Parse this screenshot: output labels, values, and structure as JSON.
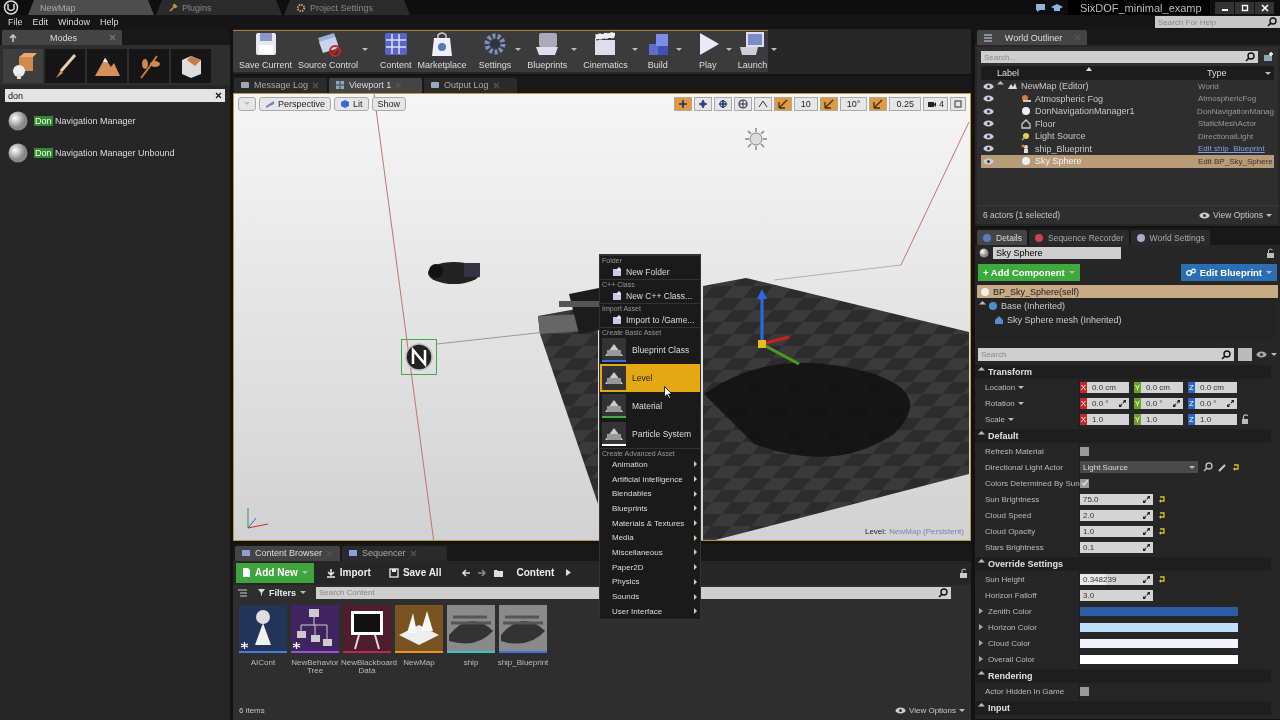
{
  "title_bar": {
    "tabs": [
      {
        "label": "NewMap",
        "selected": true
      },
      {
        "label": "Plugins",
        "selected": false
      },
      {
        "label": "Project Settings",
        "selected": false
      }
    ],
    "project": "SixDOF_minimal_examp"
  },
  "menu_bar": {
    "items": [
      "File",
      "Edit",
      "Window",
      "Help"
    ],
    "help_search": {
      "placeholder": "Search For Help"
    }
  },
  "modes_panel": {
    "tab": "Modes",
    "modes": [
      {
        "selected": true
      },
      {
        "selected": false
      },
      {
        "selected": false
      },
      {
        "selected": false
      },
      {
        "selected": false
      }
    ],
    "search": {
      "value": "don"
    },
    "results": [
      {
        "match": "Don",
        "rest": "Navigation Manager"
      },
      {
        "match": "Don",
        "rest": "Navigation Manager Unbound"
      }
    ]
  },
  "toolbar": [
    {
      "label": "Save Current",
      "dropdown": false
    },
    {
      "label": "Source Control",
      "dropdown": true
    },
    {
      "label": "Content",
      "dropdown": false
    },
    {
      "label": "Marketplace",
      "dropdown": false
    },
    {
      "label": "Settings",
      "dropdown": true
    },
    {
      "label": "Blueprints",
      "dropdown": true
    },
    {
      "label": "Cinematics",
      "dropdown": true
    },
    {
      "label": "Build",
      "dropdown": true
    },
    {
      "label": "Play",
      "dropdown": true
    },
    {
      "label": "Launch",
      "dropdown": true
    }
  ],
  "viewport": {
    "tabs": [
      {
        "label": "Message Log",
        "selected": false
      },
      {
        "label": "Viewport 1",
        "selected": true
      },
      {
        "label": "Output Log",
        "selected": false
      }
    ],
    "view_buttons": [
      "Perspective",
      "Lit",
      "Show"
    ],
    "transform_tools": [
      {
        "selected": true
      },
      {
        "selected": false
      },
      {
        "selected": false
      }
    ],
    "snaps": [
      {
        "value": "10",
        "on": true
      },
      {
        "value": "10°",
        "on": true
      },
      {
        "value": "0.25",
        "on": true
      }
    ],
    "camera_speed": "4",
    "level_label": "Level:",
    "level_name": "NewMap (Persistent)"
  },
  "context_menu": {
    "sections": [
      {
        "heading": "Folder",
        "kind": "small",
        "items": [
          {
            "label": "New Folder",
            "selected": false
          }
        ]
      },
      {
        "heading": "C++ Class",
        "kind": "small",
        "items": [
          {
            "label": "New C++ Class...",
            "selected": false
          }
        ]
      },
      {
        "heading": "Import Asset",
        "kind": "small",
        "items": [
          {
            "label": "Import to /Game...",
            "selected": false
          }
        ]
      },
      {
        "heading": "Create Basic Asset",
        "kind": "large",
        "items": [
          {
            "label": "Blueprint Class",
            "selected": false,
            "color": "#3a6fe0"
          },
          {
            "label": "Level",
            "selected": true
          },
          {
            "label": "Material",
            "selected": false,
            "color": "#3cb043"
          },
          {
            "label": "Particle System",
            "selected": false,
            "color": "#ffffff"
          }
        ]
      },
      {
        "heading": "Create Advanced Asset",
        "kind": "submenu",
        "items": [
          {
            "label": "Animation",
            "selected": false
          },
          {
            "label": "Artificial Intelligence",
            "selected": false
          },
          {
            "label": "Blendables",
            "selected": false
          },
          {
            "label": "Blueprints",
            "selected": false
          },
          {
            "label": "Materials & Textures",
            "selected": false
          },
          {
            "label": "Media",
            "selected": false
          },
          {
            "label": "Miscellaneous",
            "selected": false
          },
          {
            "label": "Paper2D",
            "selected": false
          },
          {
            "label": "Physics",
            "selected": false
          },
          {
            "label": "Sounds",
            "selected": false
          },
          {
            "label": "User Interface",
            "selected": false
          }
        ]
      }
    ]
  },
  "content_browser": {
    "tabs": [
      {
        "label": "Content Browser",
        "selected": true
      },
      {
        "label": "Sequencer",
        "selected": false
      }
    ],
    "add_new": "Add New",
    "import": "Import",
    "save_all": "Save All",
    "path": "Content",
    "filters": "Filters",
    "search": {
      "placeholder": "Search Content"
    },
    "assets": [
      {
        "name": "AICont",
        "color": "#4a7be0",
        "unsaved": true
      },
      {
        "name": "NewBehavior Tree",
        "color": "#9b4fd6",
        "unsaved": true
      },
      {
        "name": "NewBlackboard Data",
        "color": "#b8285a",
        "unsaved": false
      },
      {
        "name": "NewMap",
        "color": "#e8961e",
        "unsaved": false
      },
      {
        "name": "ship",
        "color": "#35c7c7",
        "unsaved": false
      },
      {
        "name": "ship_Blueprint",
        "color": "#3f6fe0",
        "unsaved": false
      }
    ],
    "item_count": "6 items",
    "view_options": "View Options"
  },
  "world_outliner": {
    "tab": "World Outliner",
    "search": {
      "placeholder": "Search..."
    },
    "columns": [
      "Label",
      "Type"
    ],
    "rows": [
      {
        "label": "NewMap (Editor)",
        "type": "World",
        "type_link": false,
        "selected": false,
        "expanded": true,
        "children": [
          {
            "label": "Atmospheric Fog",
            "type": "AtmosphericFog",
            "type_link": false,
            "selected": false
          },
          {
            "label": "DonNavigationManager1",
            "type": "DonNavigationManag",
            "type_link": false,
            "selected": false
          },
          {
            "label": "Floor",
            "type": "StaticMeshActor",
            "type_link": false,
            "selected": false
          },
          {
            "label": "Light Source",
            "type": "DirectionalLight",
            "type_link": false,
            "selected": false
          },
          {
            "label": "ship_Blueprint",
            "type": "Edit ship_Blueprint",
            "type_link": true,
            "selected": false
          },
          {
            "label": "Sky Sphere",
            "type": "Edit BP_Sky_Sphere",
            "type_link": false,
            "selected": true
          }
        ]
      }
    ],
    "status": "6 actors (1 selected)",
    "view_options": "View Options"
  },
  "details": {
    "tabs": [
      {
        "label": "Details",
        "selected": true
      },
      {
        "label": "Sequence Recorder",
        "selected": false
      },
      {
        "label": "World Settings",
        "selected": false
      }
    ],
    "actor_name": "Sky Sphere",
    "add_component": "+ Add Component",
    "edit_blueprint": "Edit Blueprint",
    "components": [
      {
        "label": "BP_Sky_Sphere(self)",
        "selected": true
      },
      {
        "label": "Base (Inherited)",
        "selected": false,
        "expanded": true,
        "children": [
          {
            "label": "Sky Sphere mesh (Inherited)",
            "selected": false
          }
        ]
      }
    ],
    "search": {
      "placeholder": "Search"
    },
    "sections": [
      {
        "title": "Transform",
        "expanded": true,
        "rows": [
          {
            "kind": "vector",
            "label": "Location",
            "fields": [
              {
                "axis": "X",
                "color": "#c62828",
                "value": "0.0 cm",
                "spin": false
              },
              {
                "axis": "Y",
                "color": "#6aa522",
                "value": "0.0 cm",
                "spin": false
              },
              {
                "axis": "Z",
                "color": "#2a62c8",
                "value": "0.0 cm",
                "spin": false
              }
            ]
          },
          {
            "kind": "vector",
            "label": "Rotation",
            "fields": [
              {
                "axis": "X",
                "color": "#c62828",
                "value": "0.0 °",
                "spin": true
              },
              {
                "axis": "Y",
                "color": "#6aa522",
                "value": "0.0 °",
                "spin": true
              },
              {
                "axis": "Z",
                "color": "#2a62c8",
                "value": "0.0 °",
                "spin": true
              }
            ]
          },
          {
            "kind": "vector",
            "label": "Scale",
            "locked": false,
            "fields": [
              {
                "axis": "X",
                "color": "#c62828",
                "value": "1.0",
                "spin": false
              },
              {
                "axis": "Y",
                "color": "#6aa522",
                "value": "1.0",
                "spin": false
              },
              {
                "axis": "Z",
                "color": "#2a62c8",
                "value": "1.0",
                "spin": false
              }
            ]
          }
        ]
      },
      {
        "title": "Default",
        "expanded": true,
        "rows": [
          {
            "kind": "checkbox",
            "label": "Refresh Material",
            "checked": false
          },
          {
            "kind": "dropdown",
            "label": "Directional Light Actor",
            "value": "Light Source",
            "reset": true
          },
          {
            "kind": "checkbox",
            "label": "Colors Determined By Sun",
            "checked": true
          },
          {
            "kind": "number",
            "label": "Sun Brightness",
            "value": "75.0",
            "reset": true
          },
          {
            "kind": "number",
            "label": "Cloud Speed",
            "value": "2.0",
            "reset": true
          },
          {
            "kind": "number",
            "label": "Cloud Opacity",
            "value": "1.0",
            "reset": true
          },
          {
            "kind": "number",
            "label": "Stars Brightness",
            "value": "0.1",
            "reset": false
          }
        ]
      },
      {
        "title": "Override Settings",
        "expanded": true,
        "rows": [
          {
            "kind": "number",
            "label": "Sun Height",
            "value": "0.348239",
            "reset": true,
            "level": 0.35
          },
          {
            "kind": "number",
            "label": "Horizon Falloff",
            "value": "3.0",
            "reset": false
          },
          {
            "kind": "color",
            "label": "Zenith Color",
            "color": "#2c5ca4",
            "expanded": false
          },
          {
            "kind": "color",
            "label": "Horizon Color",
            "color": "#bfe0f8",
            "expanded": false
          },
          {
            "kind": "color",
            "label": "Cloud Color",
            "color": "#f2f3f8",
            "expanded": false
          },
          {
            "kind": "color",
            "label": "Overall Color",
            "color": "#ffffff",
            "expanded": false
          }
        ]
      },
      {
        "title": "Rendering",
        "expanded": true,
        "rows": [
          {
            "kind": "checkbox",
            "label": "Actor Hidden In Game",
            "checked": false
          }
        ]
      },
      {
        "title": "Input",
        "expanded": true
      }
    ]
  }
}
